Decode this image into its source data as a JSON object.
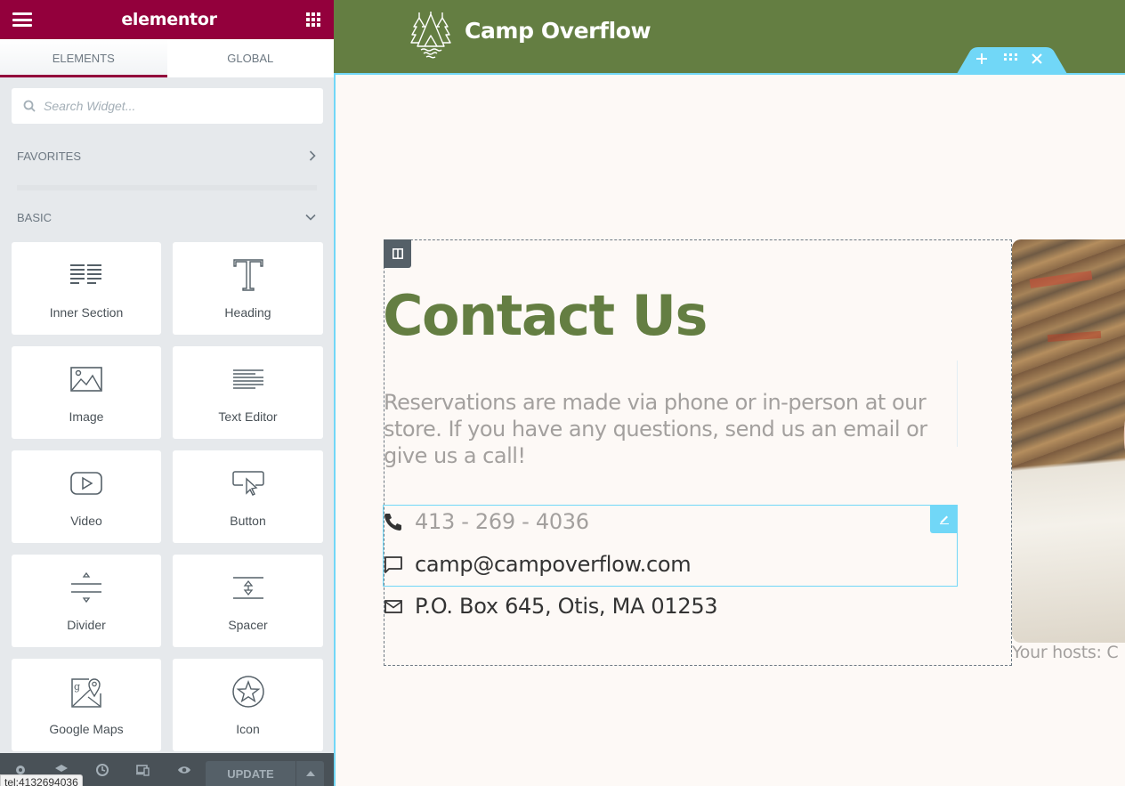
{
  "editor": {
    "brand": "elementor",
    "tabs": [
      {
        "label": "Elements",
        "active": true
      },
      {
        "label": "Global",
        "active": false
      }
    ],
    "search": {
      "placeholder": "Search Widget...",
      "value": ""
    },
    "categories": {
      "favorites": {
        "label": "Favorites",
        "state": "collapsed"
      },
      "basic": {
        "label": "Basic",
        "state": "expanded"
      }
    },
    "widgets": [
      {
        "label": "Inner Section",
        "icon": "inner-section-icon"
      },
      {
        "label": "Heading",
        "icon": "heading-icon"
      },
      {
        "label": "Image",
        "icon": "image-icon"
      },
      {
        "label": "Text Editor",
        "icon": "text-editor-icon"
      },
      {
        "label": "Video",
        "icon": "video-icon"
      },
      {
        "label": "Button",
        "icon": "button-icon"
      },
      {
        "label": "Divider",
        "icon": "divider-icon"
      },
      {
        "label": "Spacer",
        "icon": "spacer-icon"
      },
      {
        "label": "Google Maps",
        "icon": "google-maps-icon"
      },
      {
        "label": "Icon",
        "icon": "star-icon"
      }
    ],
    "footer": {
      "update_label": "Update",
      "tools": [
        "settings-icon",
        "navigator-icon",
        "history-icon",
        "responsive-icon",
        "preview-icon"
      ]
    },
    "status_tooltip": "tel:4132694036"
  },
  "colors": {
    "brand": "#93003c",
    "site_green": "#647e42",
    "editor_accent": "#71d7f7",
    "muted_text": "#a3a09e"
  },
  "page": {
    "site_title": "Camp Overflow",
    "heading": "Contact Us",
    "intro": "Reservations are made via phone or in-person at our store. If you have any questions, send us an email or give us a call!",
    "contacts": [
      {
        "icon": "phone-icon",
        "text": "413 - 269 - 4036"
      },
      {
        "icon": "chat-icon",
        "text": "camp@campoverflow.com"
      },
      {
        "icon": "envelope-icon",
        "text": "P.O. Box 645, Otis, MA 01253"
      }
    ],
    "photo_caption": "Your hosts: C"
  }
}
